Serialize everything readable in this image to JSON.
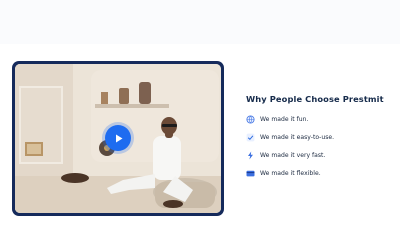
{
  "features": {
    "heading": "Why People Choose Prestmit",
    "items": [
      {
        "label": "We made it fun.",
        "icon": "globe-icon"
      },
      {
        "label": "We made it easy-to-use.",
        "icon": "check-badge-icon"
      },
      {
        "label": "We made it very fast.",
        "icon": "lightning-icon"
      },
      {
        "label": "We made it flexible.",
        "icon": "card-icon"
      }
    ]
  },
  "video": {
    "play_icon": "play-icon"
  },
  "colors": {
    "accent": "#1e6cf0",
    "frame": "#152a5b",
    "heading": "#152a4a"
  }
}
